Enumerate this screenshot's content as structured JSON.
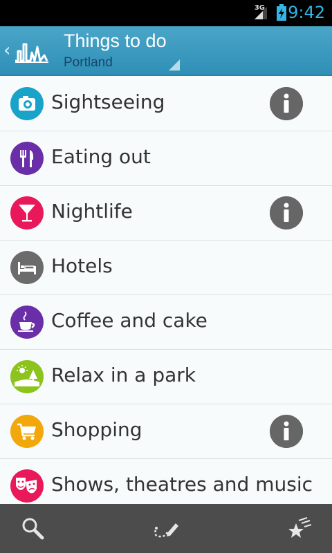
{
  "status_bar": {
    "network": "3G",
    "time": "9:42"
  },
  "action_bar": {
    "title": "Things to do",
    "subtitle": "Portland"
  },
  "categories": [
    {
      "label": "Sightseeing",
      "icon": "camera-icon",
      "color": "#1aa3c9",
      "has_info": true
    },
    {
      "label": "Eating out",
      "icon": "fork-knife-icon",
      "color": "#6a2ea8",
      "has_info": false
    },
    {
      "label": "Nightlife",
      "icon": "cocktail-icon",
      "color": "#e8185a",
      "has_info": true
    },
    {
      "label": "Hotels",
      "icon": "bed-icon",
      "color": "#6b6b6b",
      "has_info": false
    },
    {
      "label": "Coffee and cake",
      "icon": "coffee-cup-icon",
      "color": "#6a2ea8",
      "has_info": false
    },
    {
      "label": "Relax in a park",
      "icon": "park-icon",
      "color": "#8cc31d",
      "has_info": false
    },
    {
      "label": "Shopping",
      "icon": "shopping-cart-icon",
      "color": "#f2a70b",
      "has_info": true
    },
    {
      "label": "Shows, theatres and music",
      "icon": "theatre-masks-icon",
      "color": "#e8185a",
      "has_info": false
    }
  ],
  "bottom_bar": {
    "buttons": [
      "search-icon",
      "route-edit-icon",
      "favorites-icon"
    ]
  }
}
